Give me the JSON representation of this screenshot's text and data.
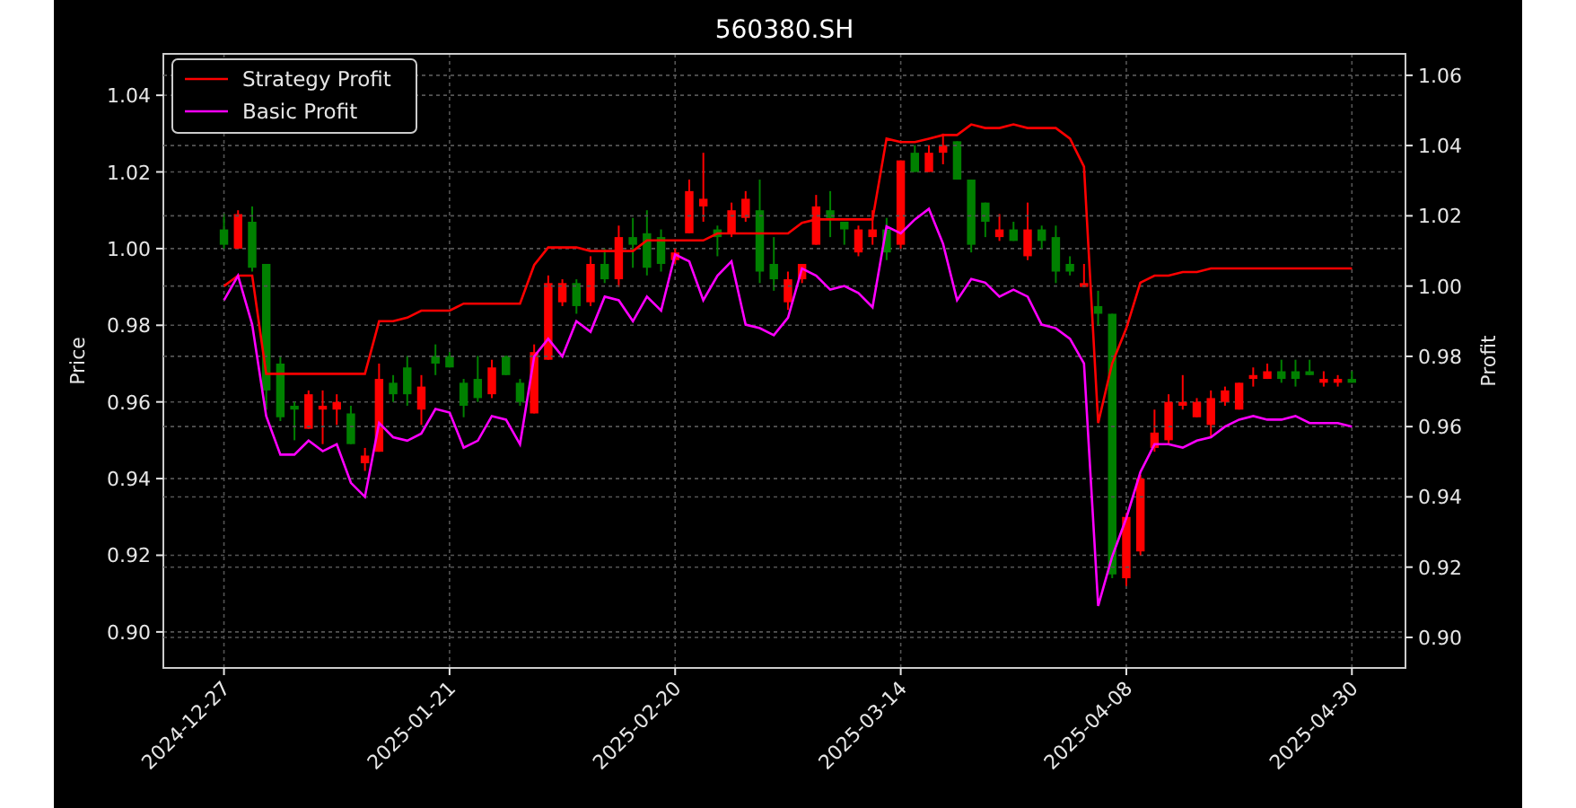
{
  "figure": {
    "title": "560380.SH"
  },
  "price_chart": {
    "chart_data": {
      "type": "candlestick",
      "ylabel": "Price",
      "grid": true,
      "categories": [
        "2024-12-27",
        null,
        null,
        null,
        null,
        null,
        null,
        null,
        null,
        null,
        null,
        null,
        null,
        null,
        null,
        null,
        "2025-01-21",
        null,
        null,
        null,
        null,
        null,
        null,
        null,
        null,
        null,
        null,
        null,
        null,
        null,
        null,
        null,
        "2025-02-20",
        null,
        null,
        null,
        null,
        null,
        null,
        null,
        null,
        null,
        null,
        null,
        null,
        null,
        null,
        null,
        "2025-03-14",
        null,
        null,
        null,
        null,
        null,
        null,
        null,
        null,
        null,
        null,
        null,
        null,
        null,
        null,
        null,
        "2025-04-08",
        null,
        null,
        null,
        null,
        null,
        null,
        null,
        null,
        null,
        null,
        null,
        null,
        null,
        null,
        null,
        "2025-04-30"
      ],
      "ylim": [
        0.8906,
        1.0508
      ],
      "yticks": [
        {
          "value": 0.9,
          "label": "0.90"
        },
        {
          "value": 0.92,
          "label": "0.92"
        },
        {
          "value": 0.94,
          "label": "0.94"
        },
        {
          "value": 0.96,
          "label": "0.96"
        },
        {
          "value": 0.98,
          "label": "0.98"
        },
        {
          "value": 1.0,
          "label": "1.00"
        },
        {
          "value": 1.02,
          "label": "1.02"
        },
        {
          "value": 1.04,
          "label": "1.04"
        }
      ],
      "ohlc": [
        [
          1.005,
          1.009,
          1.0,
          1.001
        ],
        [
          1.0,
          1.01,
          1.0,
          1.009
        ],
        [
          1.007,
          1.011,
          0.994,
          0.995
        ],
        [
          0.996,
          0.996,
          0.958,
          0.963
        ],
        [
          0.97,
          0.972,
          0.955,
          0.956
        ],
        [
          0.959,
          0.96,
          0.95,
          0.958
        ],
        [
          0.953,
          0.963,
          0.953,
          0.962
        ],
        [
          0.958,
          0.963,
          0.949,
          0.959
        ],
        [
          0.958,
          0.962,
          0.954,
          0.96
        ],
        [
          0.957,
          0.959,
          0.949,
          0.949
        ],
        [
          0.944,
          0.948,
          0.942,
          0.946
        ],
        [
          0.947,
          0.97,
          0.947,
          0.966
        ],
        [
          0.965,
          0.967,
          0.96,
          0.962
        ],
        [
          0.969,
          0.972,
          0.959,
          0.962
        ],
        [
          0.958,
          0.967,
          0.954,
          0.964
        ],
        [
          0.972,
          0.975,
          0.967,
          0.97
        ],
        [
          0.972,
          0.973,
          0.969,
          0.969
        ],
        [
          0.965,
          0.966,
          0.956,
          0.959
        ],
        [
          0.966,
          0.972,
          0.96,
          0.961
        ],
        [
          0.962,
          0.971,
          0.961,
          0.969
        ],
        [
          0.972,
          0.972,
          0.967,
          0.967
        ],
        [
          0.965,
          0.966,
          0.959,
          0.96
        ],
        [
          0.957,
          0.975,
          0.957,
          0.973
        ],
        [
          0.971,
          0.993,
          0.971,
          0.991
        ],
        [
          0.986,
          0.992,
          0.985,
          0.991
        ],
        [
          0.991,
          0.992,
          0.983,
          0.985
        ],
        [
          0.986,
          0.998,
          0.985,
          0.996
        ],
        [
          0.996,
          1.0,
          0.991,
          0.992
        ],
        [
          0.992,
          1.006,
          0.99,
          1.003
        ],
        [
          1.003,
          1.008,
          0.995,
          1.001
        ],
        [
          1.004,
          1.01,
          0.993,
          0.995
        ],
        [
          1.003,
          1.005,
          0.994,
          0.996
        ],
        [
          0.997,
          1.0,
          0.996,
          0.999
        ],
        [
          1.004,
          1.018,
          1.004,
          1.015
        ],
        [
          1.011,
          1.025,
          1.007,
          1.013
        ],
        [
          1.005,
          1.006,
          0.998,
          1.003
        ],
        [
          1.004,
          1.012,
          1.003,
          1.01
        ],
        [
          1.008,
          1.015,
          1.007,
          1.013
        ],
        [
          1.01,
          1.018,
          0.991,
          0.994
        ],
        [
          0.996,
          1.003,
          0.989,
          0.992
        ],
        [
          0.986,
          0.994,
          0.984,
          0.992
        ],
        [
          0.992,
          0.996,
          0.991,
          0.996
        ],
        [
          1.001,
          1.014,
          1.001,
          1.011
        ],
        [
          1.01,
          1.015,
          1.003,
          1.008
        ],
        [
          1.007,
          1.007,
          1.001,
          1.005
        ],
        [
          0.999,
          1.006,
          0.998,
          1.005
        ],
        [
          1.003,
          1.01,
          1.001,
          1.005
        ],
        [
          1.005,
          1.008,
          0.997,
          0.999
        ],
        [
          1.001,
          1.023,
          1.0,
          1.023
        ],
        [
          1.025,
          1.027,
          1.02,
          1.02
        ],
        [
          1.02,
          1.027,
          1.02,
          1.025
        ],
        [
          1.025,
          1.03,
          1.022,
          1.027
        ],
        [
          1.028,
          1.028,
          1.018,
          1.018
        ],
        [
          1.018,
          1.018,
          0.999,
          1.001
        ],
        [
          1.012,
          1.012,
          1.003,
          1.007
        ],
        [
          1.003,
          1.009,
          1.002,
          1.005
        ],
        [
          1.005,
          1.007,
          1.002,
          1.002
        ],
        [
          0.998,
          1.012,
          0.997,
          1.005
        ],
        [
          1.005,
          1.006,
          1.0,
          1.002
        ],
        [
          1.003,
          1.006,
          0.991,
          0.994
        ],
        [
          0.996,
          0.998,
          0.993,
          0.994
        ],
        [
          0.99,
          0.996,
          0.99,
          0.991
        ],
        [
          0.985,
          0.989,
          0.98,
          0.983
        ],
        [
          0.983,
          0.983,
          0.914,
          0.915
        ],
        [
          0.914,
          0.931,
          0.912,
          0.93
        ],
        [
          0.921,
          0.941,
          0.92,
          0.94
        ],
        [
          0.948,
          0.958,
          0.947,
          0.952
        ],
        [
          0.95,
          0.962,
          0.949,
          0.96
        ],
        [
          0.959,
          0.967,
          0.958,
          0.96
        ],
        [
          0.956,
          0.961,
          0.956,
          0.96
        ],
        [
          0.954,
          0.963,
          0.951,
          0.961
        ],
        [
          0.96,
          0.964,
          0.959,
          0.963
        ],
        [
          0.958,
          0.965,
          0.958,
          0.965
        ],
        [
          0.966,
          0.969,
          0.964,
          0.967
        ],
        [
          0.966,
          0.97,
          0.966,
          0.968
        ],
        [
          0.968,
          0.971,
          0.965,
          0.966
        ],
        [
          0.968,
          0.971,
          0.964,
          0.966
        ],
        [
          0.968,
          0.971,
          0.967,
          0.967
        ],
        [
          0.965,
          0.968,
          0.964,
          0.966
        ],
        [
          0.965,
          0.967,
          0.964,
          0.966
        ],
        [
          0.966,
          0.968,
          0.965,
          0.965
        ]
      ]
    }
  },
  "profit_chart": {
    "chart_data": {
      "type": "line",
      "ylabel": "Profit",
      "grid": true,
      "legend": true,
      "ylim": [
        0.8913,
        1.0661
      ],
      "yticks": [
        {
          "value": 0.9,
          "label": "0.90"
        },
        {
          "value": 0.92,
          "label": "0.92"
        },
        {
          "value": 0.94,
          "label": "0.94"
        },
        {
          "value": 0.96,
          "label": "0.96"
        },
        {
          "value": 0.98,
          "label": "0.98"
        },
        {
          "value": 1.0,
          "label": "1.00"
        },
        {
          "value": 1.02,
          "label": "1.02"
        },
        {
          "value": 1.04,
          "label": "1.04"
        },
        {
          "value": 1.06,
          "label": "1.06"
        }
      ],
      "series": [
        {
          "name": "Strategy Profit",
          "color": "#ff0000",
          "values": [
            1.0,
            1.003,
            1.003,
            0.975,
            0.975,
            0.975,
            0.975,
            0.975,
            0.975,
            0.975,
            0.975,
            0.99,
            0.99,
            0.991,
            0.993,
            0.993,
            0.993,
            0.995,
            0.995,
            0.995,
            0.995,
            0.995,
            1.006,
            1.011,
            1.011,
            1.011,
            1.01,
            1.01,
            1.01,
            1.01,
            1.013,
            1.013,
            1.013,
            1.013,
            1.013,
            1.015,
            1.015,
            1.015,
            1.015,
            1.015,
            1.015,
            1.018,
            1.019,
            1.019,
            1.019,
            1.019,
            1.019,
            1.042,
            1.041,
            1.041,
            1.042,
            1.043,
            1.043,
            1.046,
            1.045,
            1.045,
            1.046,
            1.045,
            1.045,
            1.045,
            1.042,
            1.034,
            0.961,
            0.978,
            0.988,
            1.001,
            1.003,
            1.003,
            1.004,
            1.004,
            1.005,
            1.005,
            1.005,
            1.005,
            1.005,
            1.005,
            1.005,
            1.005,
            1.005,
            1.005,
            1.005
          ]
        },
        {
          "name": "Basic Profit",
          "color": "#ff00ff",
          "values": [
            0.996,
            1.003,
            0.989,
            0.963,
            0.952,
            0.952,
            0.956,
            0.953,
            0.955,
            0.944,
            0.94,
            0.961,
            0.957,
            0.956,
            0.958,
            0.965,
            0.964,
            0.954,
            0.956,
            0.963,
            0.962,
            0.955,
            0.98,
            0.985,
            0.98,
            0.99,
            0.987,
            0.997,
            0.996,
            0.99,
            0.997,
            0.993,
            1.009,
            1.007,
            0.996,
            1.003,
            1.007,
            0.989,
            0.988,
            0.986,
            0.991,
            1.005,
            1.003,
            0.999,
            1.0,
            0.998,
            0.994,
            1.017,
            1.015,
            1.019,
            1.022,
            1.012,
            0.996,
            1.002,
            1.001,
            0.997,
            0.999,
            0.997,
            0.989,
            0.988,
            0.985,
            0.978,
            0.909,
            0.923,
            0.934,
            0.947,
            0.955,
            0.955,
            0.954,
            0.956,
            0.957,
            0.96,
            0.962,
            0.963,
            0.962,
            0.962,
            0.963,
            0.961,
            0.961,
            0.961,
            0.96
          ]
        }
      ]
    }
  }
}
